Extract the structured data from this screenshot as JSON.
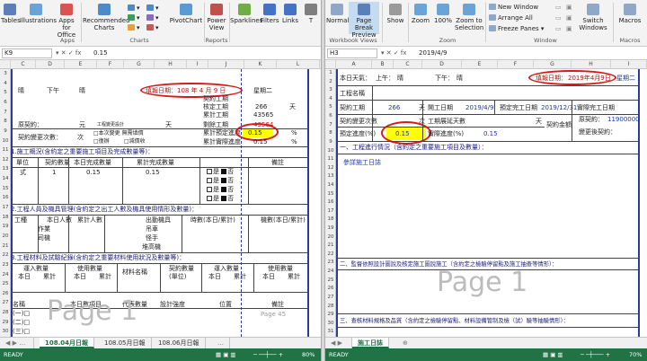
{
  "left": {
    "ribbon": {
      "tables": "Tables",
      "illustrations": "Illustrations",
      "apps_office": "Apps for Office",
      "recommended_charts": "Recommended Charts",
      "pivotchart": "PivotChart",
      "power_view": "Power View",
      "sparklines": "Sparklines",
      "filters": "Filters",
      "links": "Links",
      "t": "T",
      "group_apps": "Apps",
      "group_charts": "Charts",
      "group_reports": "Reports"
    },
    "name_box": "K9",
    "formula_value": "0.15",
    "columns": [
      "C",
      "D",
      "E",
      "F",
      "G",
      "H",
      "I",
      "J",
      "K",
      "L"
    ],
    "rows": [
      "3",
      "4",
      "5",
      "6",
      "7",
      "8",
      "9",
      "10",
      "11",
      "12",
      "13",
      "14",
      "15",
      "16",
      "17",
      "18",
      "19",
      "20",
      "21",
      "22",
      "23",
      "24",
      "25",
      "26",
      "27",
      "28",
      "29",
      "30"
    ],
    "cells": {
      "weather_am": "晴",
      "time_pm": "下午",
      "weather_pm": "晴",
      "fill_date": "填報日期：108 年 4 月 9 日",
      "weekday": "星期二",
      "contract_days": "契約工期",
      "approved_days": "核定工期",
      "approved_days_val": "266",
      "cum_days": "累計工期",
      "cum_days_val": "43565",
      "remain_days": "剩餘工期",
      "remain_days_val": "43564",
      "unit_day": "天",
      "orig_contract": "原契約：",
      "unit_yuan": "元",
      "change_design": "工程變更設計",
      "unit_day2": "天",
      "change_count": "契約變更次數：",
      "change_count_val": "第",
      "unit_ci": "次",
      "planned_progress": "累計預定進度",
      "planned_progress_val": "0.15",
      "actual_progress": "累計實際進度",
      "actual_progress_val": "0.15",
      "pct": "%",
      "pct2": "%",
      "no_change": "□本次變更 無需填價",
      "done_yes": "□復辦",
      "done_no": "□減價收",
      "section1": "1.施工概況(含約定之重要施工項目及完成數量等)：",
      "h_item": "單位",
      "h_qty": "契約數量",
      "h_today": "本日完成數量",
      "h_cum": "累計完成數量",
      "h_note": "備註",
      "row_unit": "式",
      "row_one": "1",
      "row_today": "0.15",
      "row_cum": "0.15",
      "yes": "是",
      "no": "否",
      "section2": "2.工程人員及機具管理(含約定之出工人數及機具使用情形及數量)：",
      "labor_type": "工種",
      "labor_today": "本日人數",
      "labor_cum": "累計人數",
      "machine_name": "出動機具",
      "machine_date": "時數(本日/累計)",
      "machine_count": "機數(本日/累計)",
      "worker": "作業",
      "driver": "司機",
      "crane": "吊車",
      "excavator": "怪手",
      "loader": "堆高機",
      "section3": "3.工程材料及試驗紀錄(含約定之重要材料使用狀況及數量等)：",
      "mat_in": "運入數量",
      "mat_use": "使用數量",
      "mat_name": "材料名稱",
      "mat_contract": "契約數量",
      "mat_unit": "(單位)",
      "mat_in2": "運入數量",
      "mat_use2": "使用數量",
      "today": "本日",
      "cum": "累計",
      "today2": "本日",
      "cum2": "累計",
      "name": "名稱",
      "test_today": "本日數項目",
      "rep_qty": "代表數量",
      "design": "設計強度",
      "location": "位置",
      "note2": "備註",
      "r_a": "(一)□",
      "r_b": "(二)□",
      "r_c": "(三)□",
      "watermark": "Page 1",
      "page45": "Page 45"
    },
    "tabs": [
      "108.04月日報",
      "108.05月日報",
      "108.06月日報"
    ],
    "status": "READY",
    "zoom": "80%"
  },
  "right": {
    "ribbon": {
      "normal": "Normal",
      "page_break": "Page Break Preview",
      "show": "Show",
      "zoom": "Zoom",
      "hundred": "100%",
      "zoom_sel": "Zoom to Selection",
      "new_window": "New Window",
      "arrange_all": "Arrange All",
      "freeze": "Freeze Panes",
      "switch_windows": "Switch Windows",
      "macros": "Macros",
      "group_views": "Workbook Views",
      "group_zoom": "Zoom",
      "group_window": "Window",
      "group_macros": "Macros"
    },
    "name_box": "H3",
    "formula_value": "2019/4/9",
    "columns": [
      "A",
      "B",
      "C",
      "D",
      "E",
      "F",
      "G",
      "H",
      "I"
    ],
    "rows": [
      "1",
      "2",
      "3",
      "4",
      "5",
      "6",
      "7",
      "8",
      "9",
      "10",
      "11",
      "12",
      "13",
      "14",
      "15",
      "16",
      "17",
      "18",
      "19",
      "20",
      "21",
      "22",
      "23",
      "24",
      "25",
      "26",
      "27",
      "28",
      "29",
      "30",
      "31"
    ],
    "cells": {
      "weather_am": "本日天氣：",
      "am": "上午：",
      "am_val": "晴",
      "pm": "下午：",
      "pm_val": "晴",
      "fill_date": "填報日期：",
      "fill_date_val": "2019年4月9日",
      "weekday": "星期二",
      "project_name": "工程名稱",
      "contract_days": "契約工期",
      "contract_days_val": "266",
      "unit_day": "天",
      "start_date": "開工日期",
      "start_date_val": "2019/4/9",
      "plan_finish": "預定完工日期",
      "plan_finish_val": "2019/12/31",
      "actual_finish": "實際完工日期",
      "change_count": "契約變更次數",
      "unit_ci": "次",
      "extend_days": "工期展延天數",
      "unit_day2": "天",
      "orig_contract": "原契約：",
      "orig_contract_val": "11900000",
      "contract_amount": "契約金額",
      "changed": "變更後契約：",
      "plan_progress": "預定進度(%)",
      "plan_progress_val": "0.15",
      "actual_progress": "實際進度(%)",
      "actual_progress_val": "0.15",
      "section1": "一、工程進行情況（含約定之重要施工項目及數量）：",
      "ref": "參詳施工日誌",
      "watermark": "Page 1",
      "section2": "二、監督依照設計圖說及核定施工圖說施工（含約定之檢驗停留點及施工抽查等情形）：",
      "section3": "三、查核材料規格及品質（含約定之檢驗停留點、材料設備管制及檢（試）驗等抽驗情形）："
    },
    "tabs": [
      "施工日誌"
    ],
    "status": "READY",
    "zoom": "70%"
  },
  "colors": {
    "excel_green": "#217346",
    "ribbon_bg": "#f3f3f3",
    "annotation_red": "#d81a1a",
    "highlight_yellow": "#ffff00",
    "page_break_blue": "#2b3a9c"
  }
}
